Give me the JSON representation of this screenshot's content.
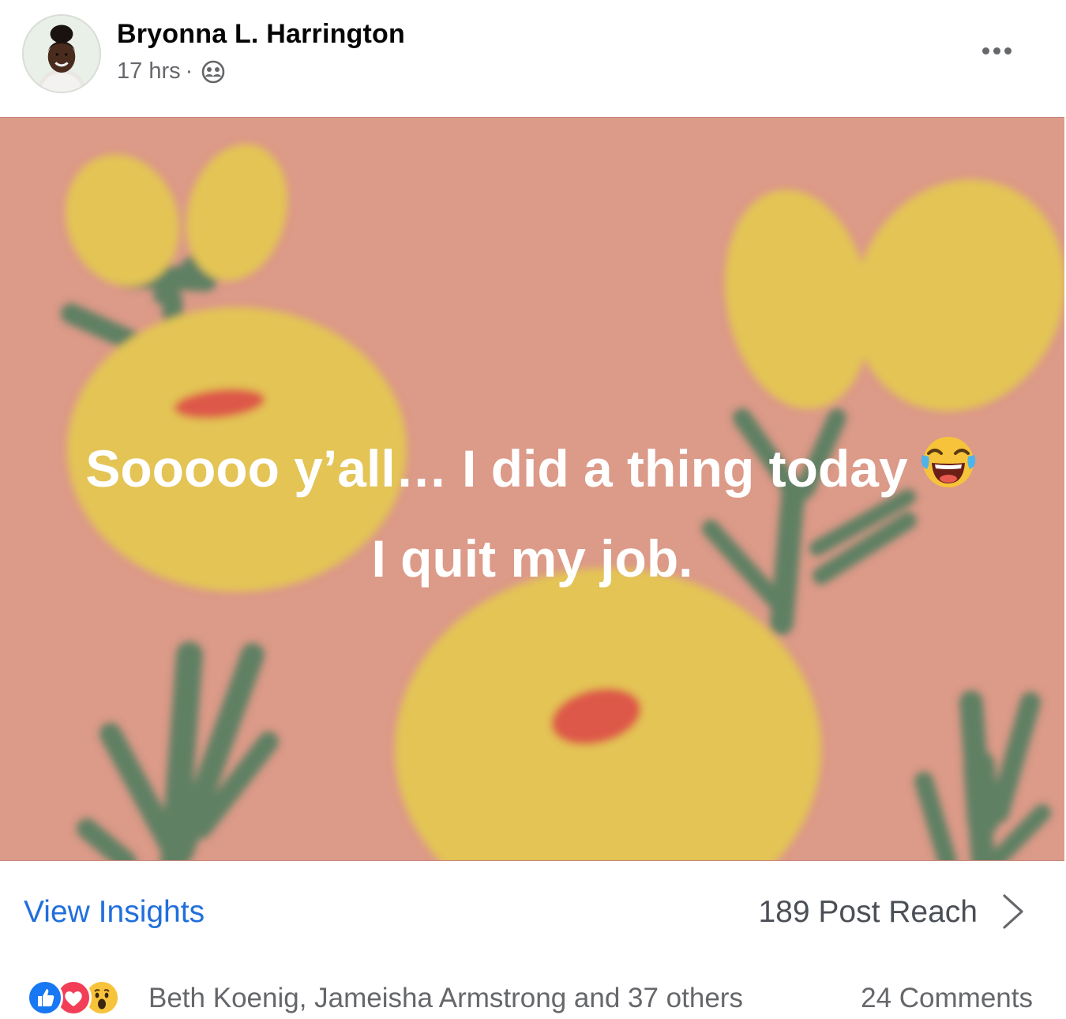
{
  "post": {
    "author": "Bryonna L. Harrington",
    "time": "17 hrs",
    "separator": "·",
    "audience_icon": "friends-icon",
    "more_icon": "more-horizontal-icon"
  },
  "status": {
    "line1": "Sooooo y’all… I did a thing today",
    "line1_emoji": "face-with-tears-of-joy-emoji",
    "line2": "I quit my job.",
    "background_color": "#dc9a88",
    "flower_color": "#e3c455",
    "stem_color": "#5f8063",
    "accent_red": "#de5848"
  },
  "insights": {
    "view_label": "View Insights",
    "reach_label": "189 Post Reach",
    "link_color": "#216fdb",
    "chevron_icon": "chevron-right-icon"
  },
  "reactions": {
    "icons": [
      "like-icon",
      "love-icon",
      "wow-icon"
    ],
    "names": "Beth Koenig, Jameisha Armstrong and 37 others",
    "comments": "24 Comments"
  }
}
